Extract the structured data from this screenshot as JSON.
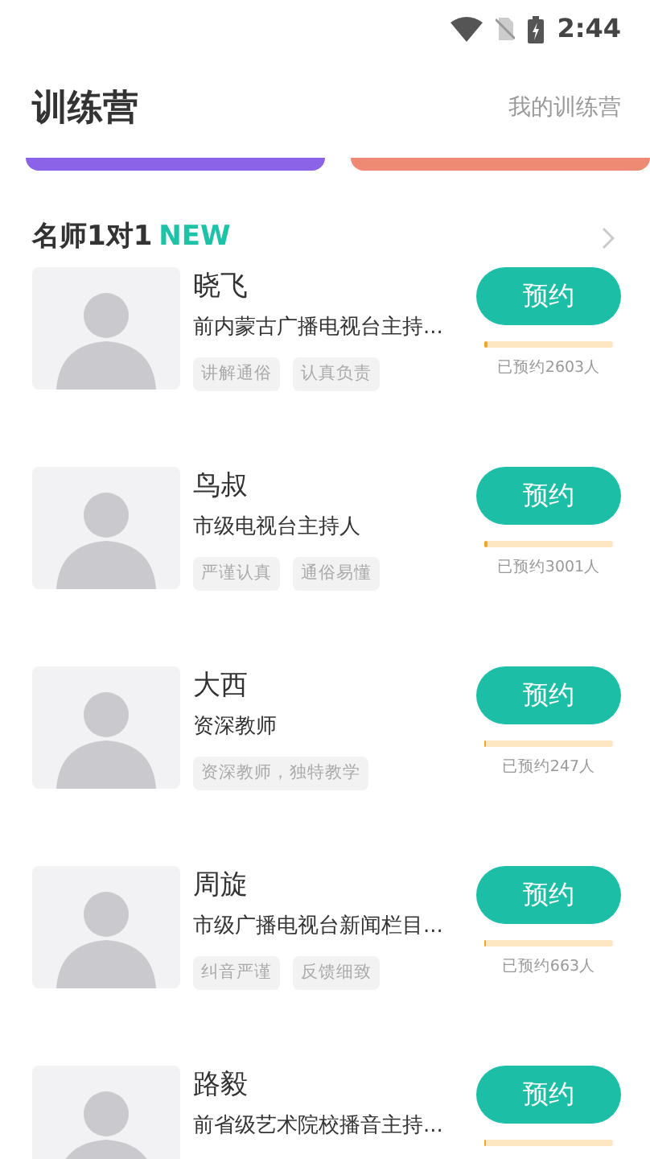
{
  "status_bar": {
    "time": "2:44"
  },
  "header": {
    "title": "训练营",
    "link": "我的训练营"
  },
  "banners": [
    {
      "color": "#8a63e6"
    },
    {
      "color": "#ee8a73"
    }
  ],
  "section": {
    "title": "名师1对1",
    "badge": "NEW"
  },
  "teachers": [
    {
      "name": "晓飞",
      "desc": "前内蒙古广播电视台主持...",
      "tags": [
        "讲解通俗",
        "认真负责"
      ],
      "button": "预约",
      "level": 0.03,
      "count": "已预约2603人"
    },
    {
      "name": "鸟叔",
      "desc": "市级电视台主持人",
      "tags": [
        "严谨认真",
        "通俗易懂"
      ],
      "button": "预约",
      "level": 0.02,
      "count": "已预约3001人"
    },
    {
      "name": "大西",
      "desc": "资深教师",
      "tags": [
        "资深教师，独特教学"
      ],
      "button": "预约",
      "level": 0.01,
      "count": "已预约247人"
    },
    {
      "name": "周旋",
      "desc": "市级广播电视台新闻栏目...",
      "tags": [
        "纠音严谨",
        "反馈细致"
      ],
      "button": "预约",
      "level": 0.01,
      "count": "已预约663人"
    },
    {
      "name": "路毅",
      "desc": "前省级艺术院校播音主持...",
      "button": "预约",
      "level": 0.01
    }
  ]
}
